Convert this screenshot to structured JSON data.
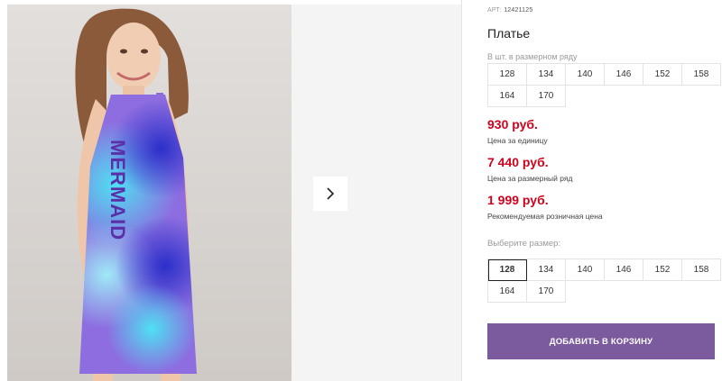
{
  "product": {
    "sku_label": "АРТ:",
    "sku_value": "12421125",
    "title": "Платье"
  },
  "series": {
    "caption": "В шт. в размерном ряду",
    "sizes": [
      "128",
      "134",
      "140",
      "146",
      "152",
      "158",
      "164",
      "170"
    ]
  },
  "prices": [
    {
      "value": "930 руб.",
      "note": "Цена за единицу"
    },
    {
      "value": "7 440 руб.",
      "note": "Цена за размерный ряд"
    },
    {
      "value": "1 999 руб.",
      "note": "Рекомендуемая розничная цена"
    }
  ],
  "size_select": {
    "caption": "Выберите размер:",
    "sizes": [
      "128",
      "134",
      "140",
      "146",
      "152",
      "158",
      "164",
      "170"
    ],
    "selected": "128"
  },
  "actions": {
    "add_to_cart": "ДОБАВИТЬ В КОРЗИНУ"
  },
  "photo": {
    "dress_print_text": "MERMAID"
  },
  "colors": {
    "price": "#d0021b",
    "button": "#7b5a9e"
  },
  "icons": {
    "next": "chevron-right-icon"
  }
}
